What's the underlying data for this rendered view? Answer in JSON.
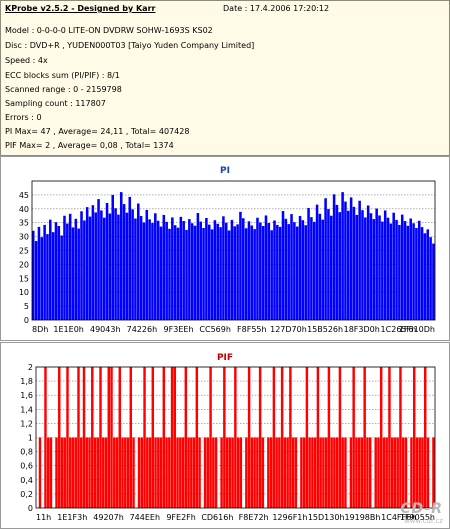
{
  "info": {
    "title_link": "KProbe v2.5.2 - Designed by Karr",
    "date": "Date : 17.4.2006 17:20:12",
    "model": "Model : 0-0-0-0 LITE-ON DVDRW SOHW-1693S KS02",
    "disc": "Disc : DVD+R , YUDEN000T03 [Taiyo Yuden Company Limited]",
    "speed": "Speed : 4x",
    "ecc": "ECC blocks sum (PI/PIF) : 8/1",
    "range": "Scanned range : 0 - 2159798",
    "sampling": "Sampling count : 117807",
    "errors": "Errors : 0",
    "pi_stats": "PI Max= 47 , Average= 24,11 , Total= 407428",
    "pif_stats": "PIF Max= 2 , Average= 0,08 , Total= 1374"
  },
  "watermark": {
    "logo": "CD-R",
    "url": "www.cdr.cz"
  },
  "colors": {
    "info_bg": "#fffbe6",
    "pi_bar": "#0000ff",
    "pif_bar": "#ff0000",
    "grid": "#808080"
  },
  "chart_data": [
    {
      "type": "bar",
      "title": "PI",
      "ylim": [
        0,
        50
      ],
      "yticks": [
        0,
        5,
        10,
        15,
        20,
        25,
        30,
        35,
        40,
        45
      ],
      "xticks": [
        "8Dh",
        "1E1E0h",
        "49043h",
        "74226h",
        "9F3EEh",
        "CC569h",
        "F8F55h",
        "127D70h",
        "15B526h",
        "18F3D0h",
        "1C265Fh",
        "1F610Dh"
      ],
      "grid": true,
      "series": [
        {
          "values": [
            32.1,
            28.4,
            33.5,
            29.8,
            34.2,
            30.9,
            36.1,
            31.6,
            35.2,
            33.8,
            30.4,
            37.5,
            34.7,
            38.2,
            33.3,
            36.4,
            32.9,
            39.1,
            35.8,
            40.6,
            37.2,
            41.3,
            38.7,
            43.5,
            39.4,
            36.8,
            42.1,
            38.3,
            45.0,
            40.2,
            37.9,
            46.0,
            41.7,
            38.6,
            44.3,
            39.8,
            36.5,
            41.9,
            37.4,
            35.1,
            39.6,
            36.2,
            34.9,
            38.4,
            35.7,
            33.6,
            37.8,
            35.3,
            32.8,
            36.9,
            34.1,
            33.2,
            37.1,
            35.6,
            32.4,
            36.3,
            34.8,
            33.9,
            38.5,
            35.4,
            33.1,
            36.7,
            34.3,
            32.6,
            35.9,
            34.6,
            33.4,
            37.3,
            35.0,
            32.2,
            36.0,
            33.7,
            34.4,
            38.9,
            36.6,
            33.0,
            35.5,
            34.0,
            32.7,
            36.8,
            35.1,
            33.8,
            37.6,
            34.9,
            32.3,
            35.8,
            34.2,
            33.5,
            39.2,
            36.4,
            34.5,
            38.1,
            35.2,
            33.6,
            37.4,
            35.9,
            34.1,
            40.3,
            37.0,
            35.3,
            41.5,
            38.2,
            36.1,
            43.8,
            39.9,
            37.5,
            45.2,
            41.4,
            38.8,
            46.0,
            42.6,
            39.3,
            44.1,
            40.7,
            37.8,
            42.9,
            39.5,
            36.9,
            41.2,
            38.4,
            36.3,
            40.1,
            37.6,
            35.4,
            39.4,
            36.8,
            34.7,
            38.6,
            36.0,
            34.2,
            37.9,
            35.6,
            33.9,
            36.5,
            34.8,
            33.1,
            35.7,
            33.4,
            31.2,
            32.6,
            29.8,
            27.5
          ]
        }
      ]
    },
    {
      "type": "bar",
      "title": "PIF",
      "ylim": [
        0,
        2
      ],
      "yticks": [
        "0",
        "0,2",
        "0,4",
        "0,6",
        "0,8",
        "1",
        "1,2",
        "1,4",
        "1,6",
        "1,8",
        "2"
      ],
      "xticks": [
        "11h",
        "1E1F3h",
        "49207h",
        "744EEh",
        "9FE2Fh",
        "CD616h",
        "F8E72h",
        "1296F1h",
        "15D130h",
        "19198Bh",
        "1C4FF6h",
        "1F9055h"
      ],
      "grid": true,
      "series": [
        {
          "values": [
            0,
            1,
            0,
            2,
            1,
            1,
            0,
            1,
            2,
            1,
            1,
            2,
            1,
            1,
            1,
            2,
            1,
            2,
            1,
            1,
            2,
            1,
            1,
            2,
            1,
            1,
            2,
            2,
            1,
            1,
            2,
            1,
            1,
            1,
            2,
            1,
            0,
            1,
            1,
            2,
            1,
            1,
            2,
            1,
            1,
            1,
            2,
            1,
            1,
            2,
            2,
            1,
            1,
            1,
            2,
            1,
            1,
            1,
            2,
            1,
            0,
            1,
            1,
            2,
            1,
            1,
            0,
            1,
            2,
            1,
            1,
            1,
            2,
            1,
            1,
            0,
            1,
            2,
            1,
            1,
            1,
            2,
            1,
            0,
            1,
            1,
            2,
            1,
            1,
            2,
            1,
            1,
            2,
            1,
            1,
            0,
            1,
            1,
            2,
            1,
            1,
            1,
            2,
            1,
            1,
            1,
            2,
            1,
            1,
            1,
            2,
            1,
            1,
            0,
            1,
            2,
            1,
            1,
            1,
            2,
            1,
            1,
            0,
            1,
            1,
            2,
            1,
            1,
            2,
            1,
            1,
            1,
            2,
            1,
            1,
            0,
            1,
            2,
            1,
            1,
            1,
            2,
            1,
            0,
            1
          ]
        }
      ]
    }
  ]
}
